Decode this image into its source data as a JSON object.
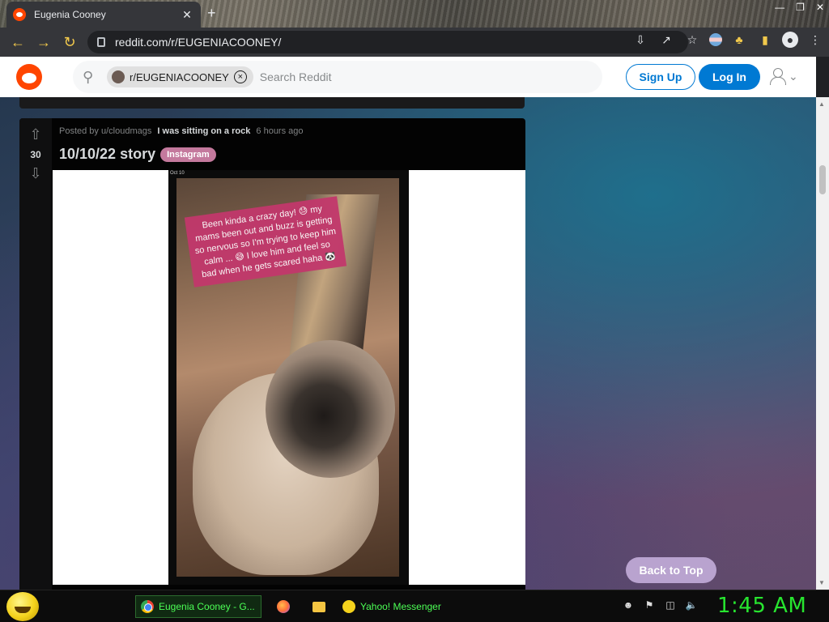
{
  "browser": {
    "tab_title": "Eugenia Cooney",
    "tab_close": "✕",
    "new_tab": "+",
    "url": "reddit.com/r/EUGENIACOONEY/"
  },
  "reddit": {
    "search": {
      "chip_label": "r/EUGENIACOONEY",
      "placeholder": "Search Reddit"
    },
    "signup_label": "Sign Up",
    "login_label": "Log In"
  },
  "post": {
    "vote_count": "30",
    "posted_by": "Posted by u/cloudmags",
    "user_flair": "I was sitting on a rock",
    "time_ago": "6 hours ago",
    "title": "10/10/22 story",
    "flair": "Instagram",
    "media_date": "Oct 10",
    "story_caption": "Been kinda a crazy day! 😓 my mams been out and buzz is getting so nervous so I'm trying to keep him calm ... 😅 I love him and feel so bad when he gets scared haha 🐼"
  },
  "back_to_top_label": "Back to Top",
  "taskbar": {
    "tasks": [
      {
        "label": "Eugenia Cooney - G..."
      },
      {
        "label": "Yahoo! Messenger"
      }
    ],
    "clock": "1:45 AM"
  },
  "colors": {
    "reddit_orange": "#ff4500",
    "reddit_blue": "#0079d3",
    "flair_pink": "#c4799d",
    "clock_green": "#27e52f"
  },
  "icons": [
    "back-arrow-icon",
    "forward-arrow-icon",
    "reload-icon",
    "lock-icon",
    "download-icon",
    "share-icon",
    "star-icon",
    "extension-icon",
    "sidebar-icon",
    "profile-icon",
    "search-icon",
    "upvote-icon",
    "downvote-icon",
    "user-icon",
    "chevron-down-icon"
  ]
}
